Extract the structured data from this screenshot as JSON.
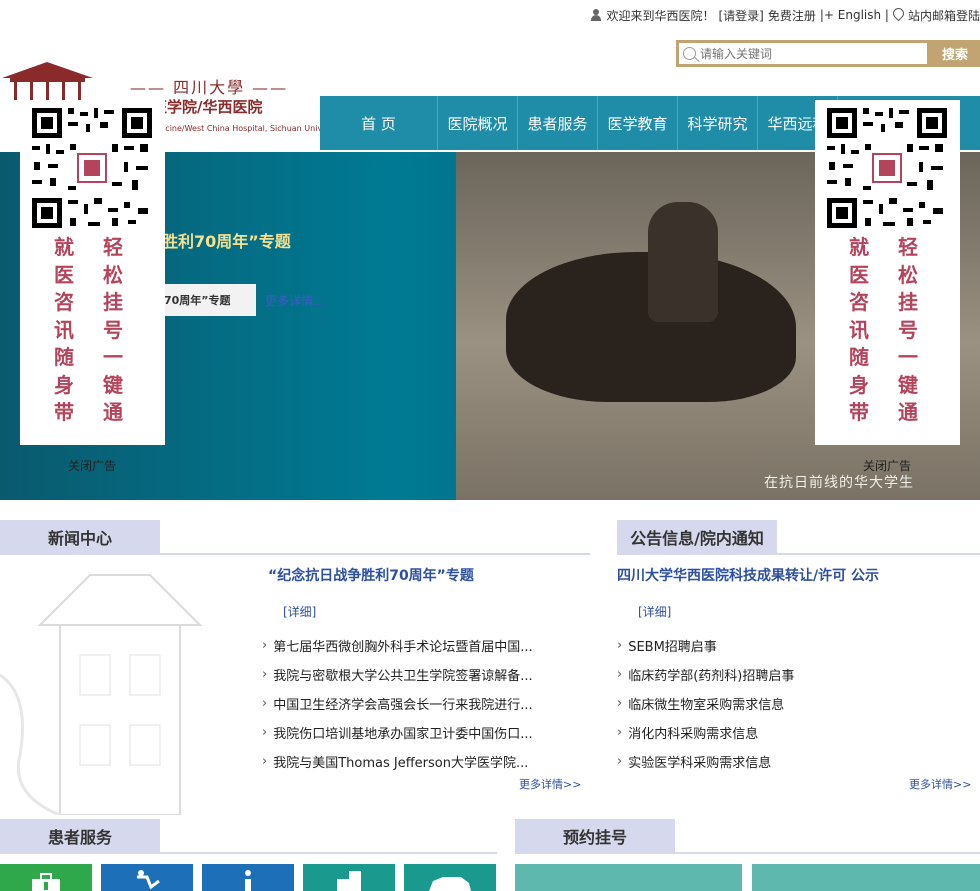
{
  "topbar": {
    "welcome": "欢迎来到华西医院！",
    "login": "[请登录]",
    "register": "免费注册",
    "english": "|+ English |",
    "mail": "站内邮箱登陆"
  },
  "search": {
    "placeholder": "请输入关键词",
    "button": "搜索"
  },
  "logo": {
    "university": "—— 四川大學 ——",
    "name_cn": "医学院/华西医院",
    "name_en": "dicine/West China Hospital, Sichuan University"
  },
  "nav": [
    "首 页",
    "医院概况",
    "患者服务",
    "医学教育",
    "科学研究",
    "华西远程"
  ],
  "banner": {
    "title": "胜利70周年”专题",
    "tag": "70周年”专题",
    "more": "更多详情...",
    "photo_caption": "在抗日前线的华大学生"
  },
  "qr_ad": {
    "col1": [
      "就",
      "医",
      "咨",
      "讯",
      "随",
      "身",
      "带"
    ],
    "col2": [
      "轻",
      "松",
      "挂",
      "号",
      "一",
      "键",
      "通"
    ],
    "close": "关闭广告"
  },
  "news": {
    "heading": "新闻中心",
    "feature": "“纪念抗日战争胜利70周年”专题",
    "detail": "[详细]",
    "items": [
      "第七届华西微创胸外科手术论坛暨首届中国...",
      "我院与密歇根大学公共卫生学院签署谅解备...",
      "中国卫生经济学会高强会长一行来我院进行...",
      "我院伤口培训基地承办国家卫计委中国伤口...",
      "我院与美国Thomas Jefferson大学医学院..."
    ],
    "more": "更多详情>>"
  },
  "notice": {
    "heading": "公告信息/院内通知",
    "feature": "四川大学华西医院科技成果转让/许可 公示",
    "detail": "[详细]",
    "items": [
      "SEBM招聘启事",
      "临床药学部(药剂科)招聘启事",
      "临床微生物室采购需求信息",
      "消化内科采购需求信息",
      "实验医学科采购需求信息"
    ],
    "more": "更多详情>>"
  },
  "patient": {
    "heading": "患者服务"
  },
  "appointment": {
    "heading": "预约挂号"
  },
  "colors": {
    "nav": "#1f8ca8",
    "accent_gold": "#c2a472",
    "section_tab": "#d6d9ee",
    "link": "#2d4fa0",
    "ad_text": "#b4445c"
  },
  "icons": [
    "user-icon",
    "location-pin-icon",
    "search-icon",
    "qr-code-icon",
    "medical-kit-icon",
    "wheelchair-icon",
    "info-icon",
    "building-icon",
    "car-icon"
  ]
}
